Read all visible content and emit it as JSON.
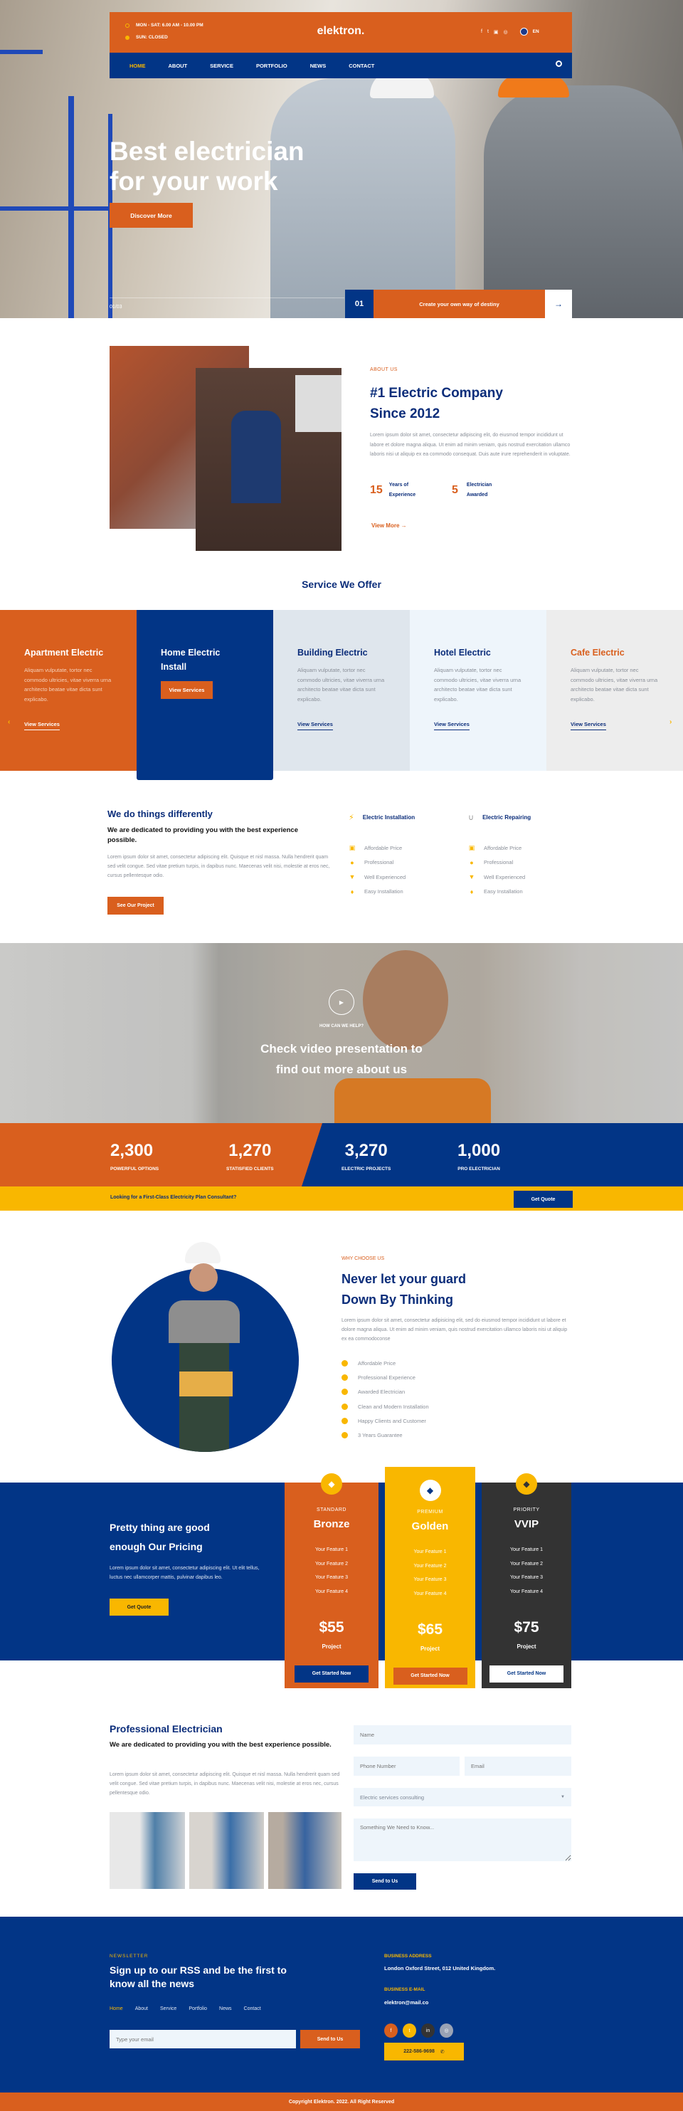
{
  "colors": {
    "orange": "#D95F1E",
    "blue": "#023586",
    "yellow": "#F9B700",
    "dark": "#333333"
  },
  "header": {
    "hours": [
      {
        "icon": "clock-icon",
        "text": "MON - SAT: 6.00 AM - 10.00 PM"
      },
      {
        "icon": "clock-icon",
        "text": "SUN: CLOSED"
      }
    ],
    "logo": "elektron.",
    "socials": [
      "facebook-icon",
      "twitter-icon",
      "linkedin-icon",
      "instagram-icon"
    ],
    "language": "EN",
    "nav": [
      "HOME",
      "ABOUT",
      "SERVICE",
      "PORTFOLIO",
      "NEWS",
      "CONTACT"
    ],
    "active_nav": "HOME"
  },
  "hero": {
    "title_line1": "Best electrician",
    "title_line2": "for your work",
    "button": "Discover More",
    "slide_counter": "01/03",
    "slide_number": "01",
    "slide_caption": "Create your own way of destiny"
  },
  "about": {
    "eyebrow": "ABOUT US",
    "title_line1": "#1 Electric Company",
    "title_line2": "Since 2012",
    "text": "Lorem ipsum dolor sit amet, consectetur adipiscing elit, do eiusmod tempor incididunt ut labore et dolore magna aliqua. Ut enim ad minim veniam, quis nostrud exercitation ullamco laboris nisi ut aliquip ex ea commodo consequat. Duis aute irure reprehenderit in voluptate.",
    "stats": [
      {
        "number": "15",
        "label1": "Years of",
        "label2": "Experience"
      },
      {
        "number": "5",
        "label1": "Electrician",
        "label2": "Awarded"
      }
    ],
    "link": "View More"
  },
  "services": {
    "title": "Service We Offer",
    "items": [
      {
        "title": "Apartment Electric",
        "text": "Aliquam vulputate, tortor nec commodo ultricies, vitae viverra urna architecto beatae vitae dicta sunt explicabo.",
        "link": "View Services"
      },
      {
        "title": "Home Electric Install",
        "button": "View Services"
      },
      {
        "title": "Building Electric",
        "text": "Aliquam vulputate, tortor nec commodo ultricies, vitae viverra urna architecto beatae vitae dicta sunt explicabo.",
        "link": "View Services"
      },
      {
        "title": "Hotel Electric",
        "text": "Aliquam vulputate, tortor nec commodo ultricies, vitae viverra urna architecto beatae vitae dicta sunt explicabo.",
        "link": "View Services"
      },
      {
        "title": "Cafe Electric",
        "text": "Aliquam vulputate, tortor nec commodo ultricies, vitae viverra urna architecto beatae vitae dicta sunt explicabo.",
        "link": "View Services"
      }
    ]
  },
  "different": {
    "title": "We do things differently",
    "subtitle": "We are dedicated to providing you with the best experience possible.",
    "text": "Lorem ipsum dolor sit amet, consectetur adipiscing elit. Quisque et nisl massa. Nulla hendrerit quam sed velit congue. Sed vitae pretium turpis, in dapibus nunc. Maecenas velit nisi, molestie at eros nec, cursus pellentesque odio.",
    "button": "See Our Project",
    "columns": [
      {
        "title": "Electric Installation",
        "icon": "lightning-icon",
        "items": [
          "Affordable Price",
          "Professional",
          "Well Experienced",
          "Easy Installation"
        ]
      },
      {
        "title": "Electric Repairing",
        "icon": "plug-icon",
        "items": [
          "Affordable Price",
          "Professional",
          "Well Experienced",
          "Easy Installation"
        ]
      }
    ]
  },
  "video": {
    "eyebrow": "HOW CAN WE HELP?",
    "title_line1": "Check video presentation to",
    "title_line2": "find out more about us"
  },
  "counters": [
    {
      "value": "2,300",
      "label": "POWERFUL OPTIONS"
    },
    {
      "value": "1,270",
      "label": "STATISFIED CLIENTS"
    },
    {
      "value": "3,270",
      "label": "ELECTRIC PROJECTS"
    },
    {
      "value": "1,000",
      "label": "PRO ELECTRICIAN"
    }
  ],
  "cta": {
    "text": "Looking for a First-Class Electricity Plan Consultant?",
    "button": "Get Quote"
  },
  "why": {
    "eyebrow": "WHY CHOOSE US",
    "title_line1": "Never let your guard",
    "title_line2": "Down By Thinking",
    "text": "Lorem ipsum dolor sit amet, consectetur adipisicing elit, sed do eiusmod tempor incididunt ut labore et dolore magna aliqua. Ut enim ad minim veniam, quis nostrud exercitation ullamco laboris nisi ut aliquip ex ea commodoconse",
    "items": [
      "Affordable Price",
      "Professional Experience",
      "Awarded Electrician",
      "Clean and Modern Installation",
      "Happy Clients and Customer",
      "3 Years Guarantee"
    ]
  },
  "pricing": {
    "title_line1": "Pretty thing are good",
    "title_line2": "enough Our Pricing",
    "text": "Lorem ipsum dolor sit amet, consectetur adipiscing elit. Ut elit tellus, luctus nec ullamcorper mattis, pulvinar dapibus leo.",
    "button": "Get Quote",
    "plans": [
      {
        "tier": "STANDARD",
        "name": "Bronze",
        "features": [
          "Your Feature 1",
          "Your Feature 2",
          "Your Feature 3",
          "Your Feature 4"
        ],
        "price": "$55",
        "unit": "Project",
        "button": "Get Started Now"
      },
      {
        "tier": "PREMIUM",
        "name": "Golden",
        "features": [
          "Your Feature 1",
          "Your Feature 2",
          "Your Feature 3",
          "Your Feature 4"
        ],
        "price": "$65",
        "unit": "Project",
        "button": "Get Started Now"
      },
      {
        "tier": "PRIORITY",
        "name": "VVIP",
        "features": [
          "Your Feature 1",
          "Your Feature 2",
          "Your Feature 3",
          "Your Feature 4"
        ],
        "price": "$75",
        "unit": "Project",
        "button": "Get Started Now"
      }
    ]
  },
  "contact": {
    "title": "Professional Electrician",
    "subtitle": "We are dedicated to providing you with the best experience possible.",
    "text": "Lorem ipsum dolor sit amet, consectetur adipiscing elit. Quisque et nisl massa. Nulla hendrerit quam sed velit congue. Sed vitae pretium turpis, in dapibus nunc. Maecenas velit nisi, molestie at eros nec, cursus pellentesque odio.",
    "form": {
      "name_placeholder": "Name",
      "phone_placeholder": "Phone Number",
      "email_placeholder": "Email",
      "service_value": "Electric services consulting",
      "message_placeholder": "Something We Need to Know...",
      "submit": "Send to Us"
    }
  },
  "footer": {
    "eyebrow": "NEWSLETTER",
    "title_line1": "Sign up to our RSS and be the first to",
    "title_line2": "know all the news",
    "nav": [
      "Home",
      "About",
      "Service",
      "Portfolio",
      "News",
      "Contact"
    ],
    "email_placeholder": "Type your email",
    "submit": "Send to Us",
    "address_label": "BUSINESS ADDRESS",
    "address": "London Oxford Street, 012 United Kingdom.",
    "email_label": "BUSINESS E-MAIL",
    "email": "elektron@mail.co",
    "socials": [
      "facebook-icon",
      "twitter-icon",
      "linkedin-icon",
      "instagram-icon"
    ],
    "phone": "222-586-9698",
    "copyright": "Copyright Elektron. 2022. All Right Reserved"
  }
}
